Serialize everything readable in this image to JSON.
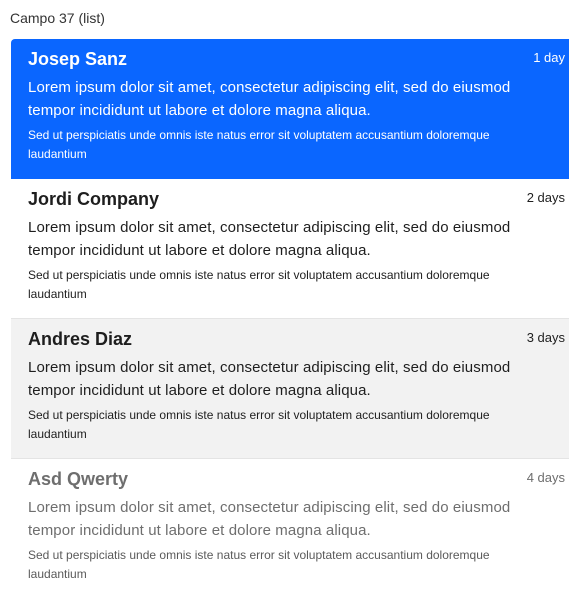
{
  "field": {
    "label": "Campo 37 (list)"
  },
  "items": [
    {
      "title": "Josep Sanz",
      "when": "1 day",
      "body": "Lorem ipsum dolor sit amet, consectetur adipiscing elit, sed do eiusmod tempor incididunt ut labore et dolore magna aliqua.",
      "sub": "Sed ut perspiciatis unde omnis iste natus error sit voluptatem accusantium doloremque laudantium",
      "state": "selected"
    },
    {
      "title": "Jordi Company",
      "when": "2 days",
      "body": "Lorem ipsum dolor sit amet, consectetur adipiscing elit, sed do eiusmod tempor incididunt ut labore et dolore magna aliqua.",
      "sub": "Sed ut perspiciatis unde omnis iste natus error sit voluptatem accusantium doloremque laudantium",
      "state": "normal"
    },
    {
      "title": "Andres Diaz",
      "when": "3 days",
      "body": "Lorem ipsum dolor sit amet, consectetur adipiscing elit, sed do eiusmod tempor incididunt ut labore et dolore magna aliqua.",
      "sub": "Sed ut perspiciatis unde omnis iste natus error sit voluptatem accusantium doloremque laudantium",
      "state": "hover"
    },
    {
      "title": "Asd Qwerty",
      "when": "4 days",
      "body": "Lorem ipsum dolor sit amet, consectetur adipiscing elit, sed do eiusmod tempor incididunt ut labore et dolore magna aliqua.",
      "sub": "Sed ut perspiciatis unde omnis iste natus error sit voluptatem accusantium doloremque laudantium",
      "state": "disabled"
    }
  ],
  "colors": {
    "selected_bg": "#0a66ff",
    "hover_bg": "#f2f2f2",
    "disabled_text": "#6e6e6e"
  }
}
